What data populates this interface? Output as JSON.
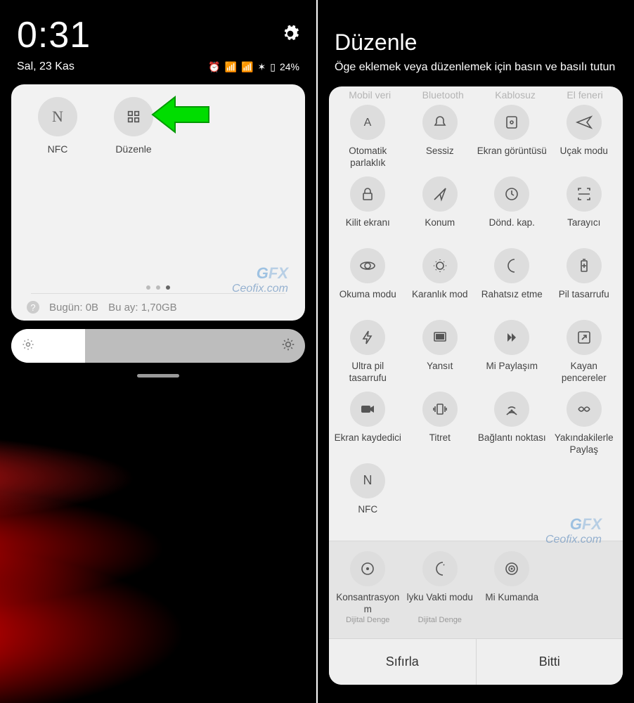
{
  "left": {
    "clock": "0:31",
    "date": "Sal, 23 Kas",
    "battery_pct": "24%",
    "tiles": [
      {
        "name": "nfc-tile",
        "label": "NFC"
      },
      {
        "name": "edit-tile",
        "label": "Düzenle"
      }
    ],
    "usage_today_label": "Bugün: 0B",
    "usage_month_label": "Bu ay: 1,70GB"
  },
  "right": {
    "title": "Düzenle",
    "subtitle": "Öge eklemek veya düzenlemek için basın ve basılı tutun",
    "faded": [
      "Mobil veri",
      "Bluetooth",
      "Kablosuz",
      "El feneri"
    ],
    "tiles": [
      {
        "name": "auto-brightness",
        "label": "Otomatik parlaklık"
      },
      {
        "name": "silent",
        "label": "Sessiz"
      },
      {
        "name": "screenshot",
        "label": "Ekran görüntüsü"
      },
      {
        "name": "airplane",
        "label": "Uçak modu"
      },
      {
        "name": "lock-screen",
        "label": "Kilit ekranı"
      },
      {
        "name": "location",
        "label": "Konum"
      },
      {
        "name": "rotate-off",
        "label": "Dönd. kap."
      },
      {
        "name": "scanner",
        "label": "Tarayıcı"
      },
      {
        "name": "reading-mode",
        "label": "Okuma modu"
      },
      {
        "name": "dark-mode",
        "label": "Karanlık mod"
      },
      {
        "name": "dnd",
        "label": "Rahatsız etme"
      },
      {
        "name": "battery-saver",
        "label": "Pil tasarrufu"
      },
      {
        "name": "ultra-battery",
        "label": "Ultra pil tasarrufu"
      },
      {
        "name": "cast",
        "label": "Yansıt"
      },
      {
        "name": "mi-share",
        "label": "Mi Paylaşım"
      },
      {
        "name": "floating",
        "label": "Kayan pencereler"
      },
      {
        "name": "screen-recorder",
        "label": "Ekran kaydedici"
      },
      {
        "name": "vibrate",
        "label": "Titret"
      },
      {
        "name": "hotspot",
        "label": "Bağlantı noktası"
      },
      {
        "name": "nearby-share",
        "label": "Yakındakilerle Paylaş"
      },
      {
        "name": "nfc",
        "label": "NFC"
      }
    ],
    "extra": [
      {
        "name": "focus-mode",
        "label": "Konsantrasyon m",
        "sub": "Dijital Denge"
      },
      {
        "name": "bedtime",
        "label": "lyku Vakti modu",
        "sub": "Dijital Denge"
      },
      {
        "name": "mi-remote",
        "label": "Mi Kumanda",
        "sub": ""
      }
    ],
    "reset_label": "Sıfırla",
    "done_label": "Bitti"
  },
  "watermark": {
    "gfx": "GFX",
    "url": "Ceofix.com"
  }
}
